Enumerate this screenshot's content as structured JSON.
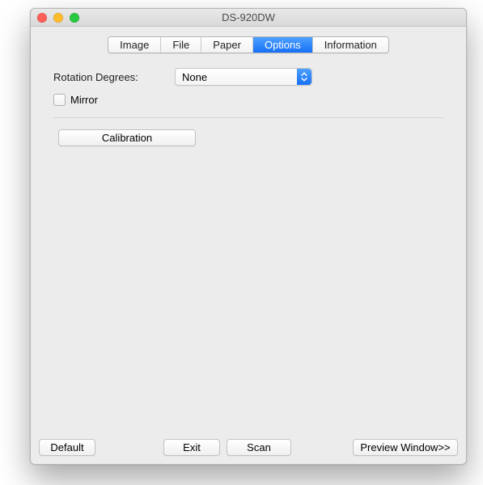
{
  "window": {
    "title": "DS-920DW"
  },
  "tabs": {
    "image": "Image",
    "file": "File",
    "paper": "Paper",
    "options": "Options",
    "information": "Information"
  },
  "options": {
    "rotation_label": "Rotation Degrees:",
    "rotation_value": "None",
    "mirror_label": "Mirror",
    "calibration_label": "Calibration"
  },
  "buttons": {
    "default": "Default",
    "exit": "Exit",
    "scan": "Scan",
    "preview": "Preview Window>>"
  }
}
